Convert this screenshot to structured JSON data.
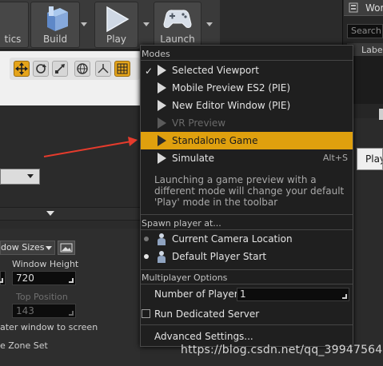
{
  "toolbar": {
    "cinematics_partial": "tics",
    "build_label": "Build",
    "play_label": "Play",
    "launch_label": "Launch"
  },
  "outliner": {
    "tab_partial": "Wor",
    "search_placeholder": "Search",
    "label_col_partial": "Labe"
  },
  "tooltip_partial": "Play",
  "modes_menu": {
    "modes_heading": "Modes",
    "items": [
      {
        "label": "Selected Viewport",
        "checked": true,
        "state": "normal"
      },
      {
        "label": "Mobile Preview ES2 (PIE)",
        "state": "normal"
      },
      {
        "label": "New Editor Window (PIE)",
        "state": "normal"
      },
      {
        "label": "VR Preview",
        "state": "disabled"
      },
      {
        "label": "Standalone Game",
        "state": "highlighted"
      },
      {
        "label": "Simulate",
        "shortcut": "Alt+S",
        "state": "normal"
      }
    ],
    "description": "Launching a game preview with a different mode will change your default 'Play' mode in the toolbar",
    "spawn_heading": "Spawn player at...",
    "spawn_options": [
      {
        "label": "Current Camera Location",
        "selected": false
      },
      {
        "label": "Default Player Start",
        "selected": true
      }
    ],
    "multiplayer_heading": "Multiplayer Options",
    "num_players_label": "Number of Players",
    "num_players_value": "1",
    "dedicated_server_label": "Run Dedicated Server",
    "advanced_label": "Advanced Settings..."
  },
  "settings_panel": {
    "window_sizes_partial": "dow Sizes",
    "window_height_label": "Window Height",
    "window_height_value": "720",
    "top_position_label": "Top Position",
    "top_position_value": "143",
    "center_window_partial": "ater window to screen",
    "zone_set_partial": "e Zone Set"
  },
  "watermark": "https://blog.csdn.net/qq_39947564",
  "colors": {
    "highlight": "#dfa00e",
    "menu_bg": "#1f1f1f",
    "arrow": "#e53b2c"
  }
}
